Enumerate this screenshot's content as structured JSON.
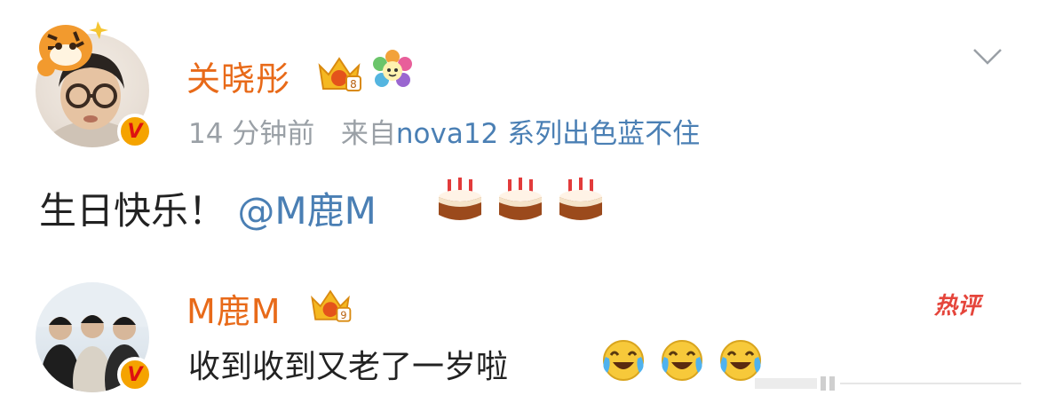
{
  "post": {
    "username": "关晓彤",
    "time": "14 分钟前",
    "source_prefix": "来自",
    "source_device": "nova12 系列出色蓝不住",
    "text": "生日快乐！",
    "mention": "@M鹿M",
    "emoji_count": 3,
    "emoji": "birthday-cake-icon"
  },
  "reply": {
    "username": "M鹿M",
    "hot_label": "热评",
    "text": "收到收到又老了一岁啦",
    "emoji_count": 3,
    "emoji": "laughing-crying-icon"
  },
  "colors": {
    "username": "#e86a19",
    "meta": "#9aa0a6",
    "link": "#4a7fb4",
    "text": "#222222",
    "hot": "#e5453b",
    "badge": "#f5a300"
  }
}
